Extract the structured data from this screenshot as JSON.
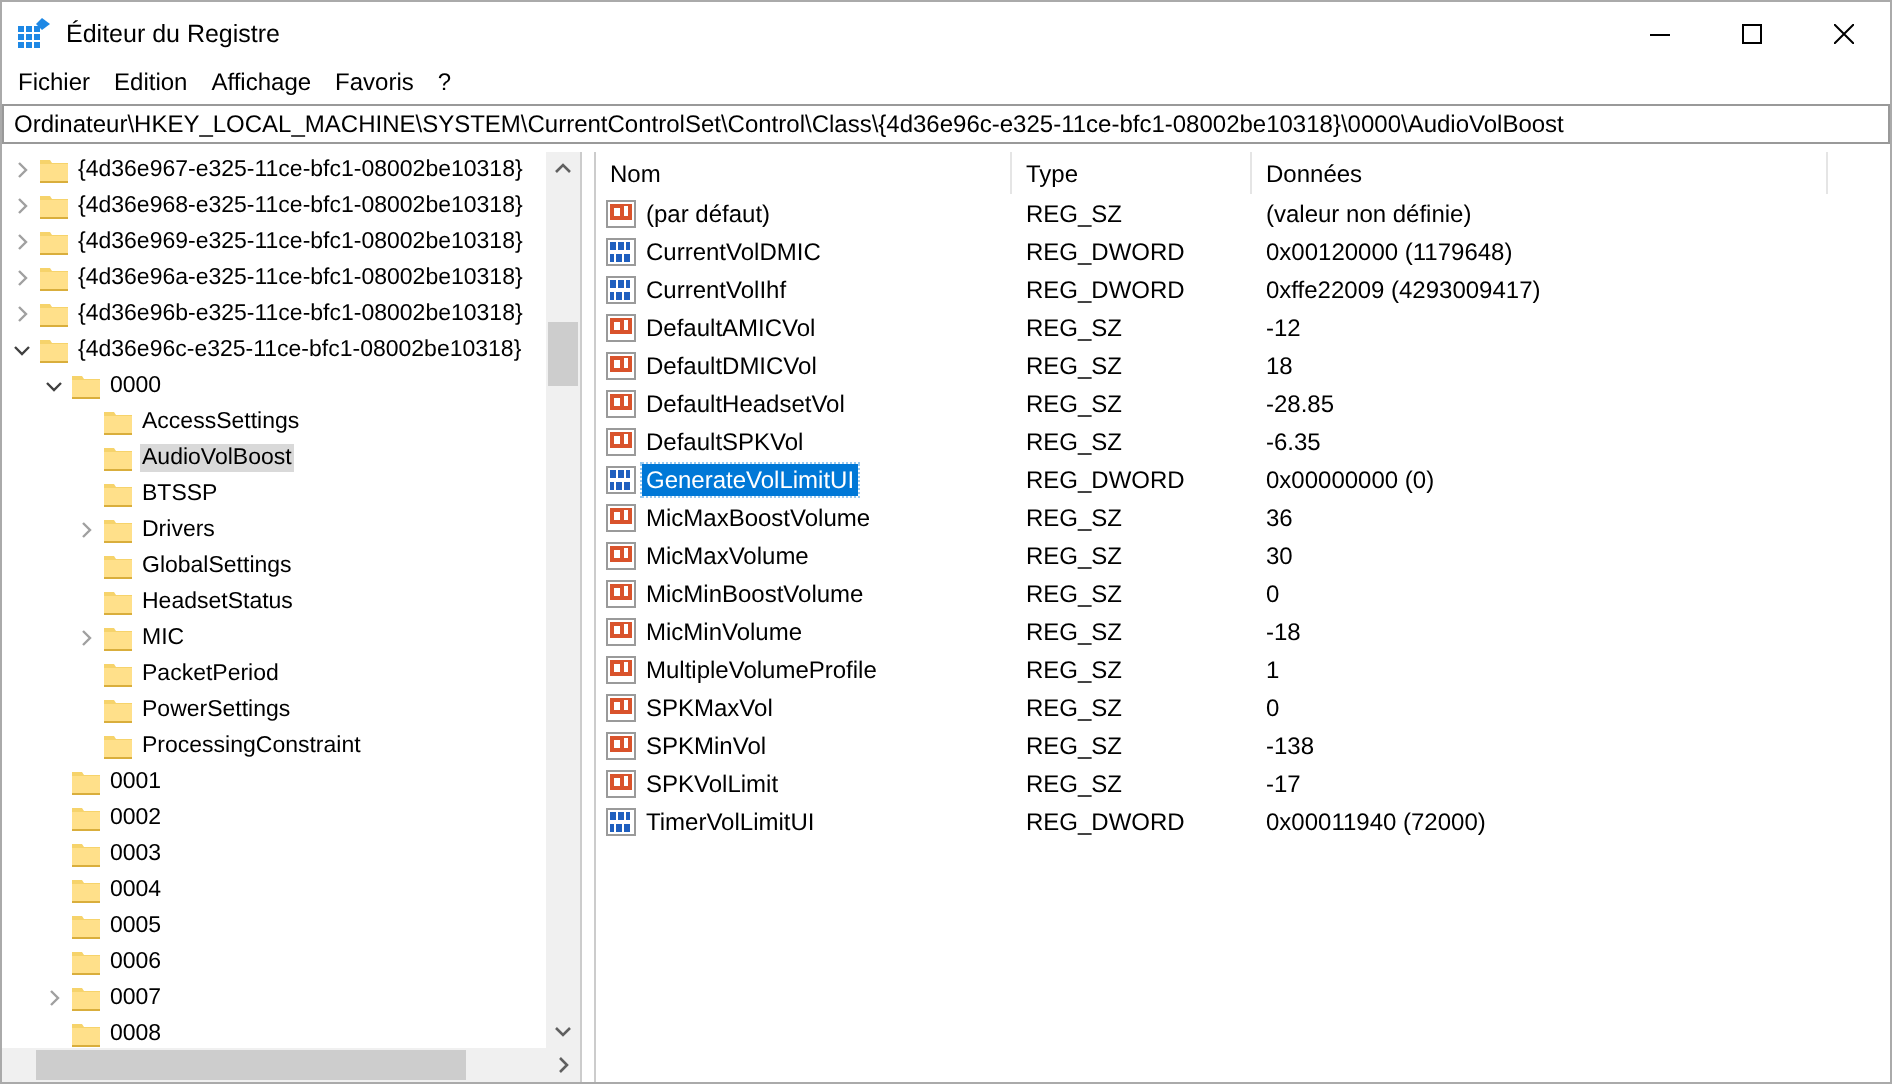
{
  "window": {
    "title": "Éditeur du Registre"
  },
  "menu": [
    "Fichier",
    "Edition",
    "Affichage",
    "Favoris",
    "?"
  ],
  "address": "Ordinateur\\HKEY_LOCAL_MACHINE\\SYSTEM\\CurrentControlSet\\Control\\Class\\{4d36e96c-e325-11ce-bfc1-08002be10318}\\0000\\AudioVolBoost",
  "tree": [
    {
      "label": "{4d36e967-e325-11ce-bfc1-08002be10318}",
      "expanded": false,
      "selected": false
    },
    {
      "label": "{4d36e968-e325-11ce-bfc1-08002be10318}",
      "expanded": false,
      "selected": false
    },
    {
      "label": "{4d36e969-e325-11ce-bfc1-08002be10318}",
      "expanded": false,
      "selected": false
    },
    {
      "label": "{4d36e96a-e325-11ce-bfc1-08002be10318}",
      "expanded": false,
      "selected": false
    },
    {
      "label": "{4d36e96b-e325-11ce-bfc1-08002be10318}",
      "expanded": false,
      "selected": false
    },
    {
      "label": "{4d36e96c-e325-11ce-bfc1-08002be10318}",
      "expanded": true,
      "selected": false,
      "children": [
        {
          "label": "0000",
          "expanded": true,
          "selected": false,
          "children": [
            {
              "label": "AccessSettings",
              "selected": false
            },
            {
              "label": "AudioVolBoost",
              "selected": true
            },
            {
              "label": "BTSSP",
              "selected": false
            },
            {
              "label": "Drivers",
              "expanded": false,
              "selected": false
            },
            {
              "label": "GlobalSettings",
              "selected": false
            },
            {
              "label": "HeadsetStatus",
              "selected": false
            },
            {
              "label": "MIC",
              "expanded": false,
              "selected": false
            },
            {
              "label": "PacketPeriod",
              "selected": false
            },
            {
              "label": "PowerSettings",
              "selected": false
            },
            {
              "label": "ProcessingConstraint",
              "selected": false
            }
          ]
        },
        {
          "label": "0001",
          "selected": false
        },
        {
          "label": "0002",
          "selected": false
        },
        {
          "label": "0003",
          "selected": false
        },
        {
          "label": "0004",
          "selected": false
        },
        {
          "label": "0005",
          "selected": false
        },
        {
          "label": "0006",
          "selected": false
        },
        {
          "label": "0007",
          "expanded": false,
          "selected": false
        },
        {
          "label": "0008",
          "selected": false
        }
      ]
    }
  ],
  "list": {
    "columns": [
      "Nom",
      "Type",
      "Données"
    ],
    "rows": [
      {
        "kind": "string",
        "name": "(par défaut)",
        "type": "REG_SZ",
        "data": "(valeur non définie)",
        "selected": false
      },
      {
        "kind": "binary",
        "name": "CurrentVolDMIC",
        "type": "REG_DWORD",
        "data": "0x00120000 (1179648)",
        "selected": false
      },
      {
        "kind": "binary",
        "name": "CurrentVolIhf",
        "type": "REG_DWORD",
        "data": "0xffe22009 (4293009417)",
        "selected": false
      },
      {
        "kind": "string",
        "name": "DefaultAMICVol",
        "type": "REG_SZ",
        "data": "-12",
        "selected": false
      },
      {
        "kind": "string",
        "name": "DefaultDMICVol",
        "type": "REG_SZ",
        "data": "18",
        "selected": false
      },
      {
        "kind": "string",
        "name": "DefaultHeadsetVol",
        "type": "REG_SZ",
        "data": "-28.85",
        "selected": false
      },
      {
        "kind": "string",
        "name": "DefaultSPKVol",
        "type": "REG_SZ",
        "data": "-6.35",
        "selected": false
      },
      {
        "kind": "binary",
        "name": "GenerateVolLimitUI",
        "type": "REG_DWORD",
        "data": "0x00000000 (0)",
        "selected": true
      },
      {
        "kind": "string",
        "name": "MicMaxBoostVolume",
        "type": "REG_SZ",
        "data": "36",
        "selected": false
      },
      {
        "kind": "string",
        "name": "MicMaxVolume",
        "type": "REG_SZ",
        "data": "30",
        "selected": false
      },
      {
        "kind": "string",
        "name": "MicMinBoostVolume",
        "type": "REG_SZ",
        "data": "0",
        "selected": false
      },
      {
        "kind": "string",
        "name": "MicMinVolume",
        "type": "REG_SZ",
        "data": "-18",
        "selected": false
      },
      {
        "kind": "string",
        "name": "MultipleVolumeProfile",
        "type": "REG_SZ",
        "data": "1",
        "selected": false
      },
      {
        "kind": "string",
        "name": "SPKMaxVol",
        "type": "REG_SZ",
        "data": "0",
        "selected": false
      },
      {
        "kind": "string",
        "name": "SPKMinVol",
        "type": "REG_SZ",
        "data": "-138",
        "selected": false
      },
      {
        "kind": "string",
        "name": "SPKVolLimit",
        "type": "REG_SZ",
        "data": "-17",
        "selected": false
      },
      {
        "kind": "binary",
        "name": "TimerVolLimitUI",
        "type": "REG_DWORD",
        "data": "0x00011940 (72000)",
        "selected": false
      }
    ]
  }
}
